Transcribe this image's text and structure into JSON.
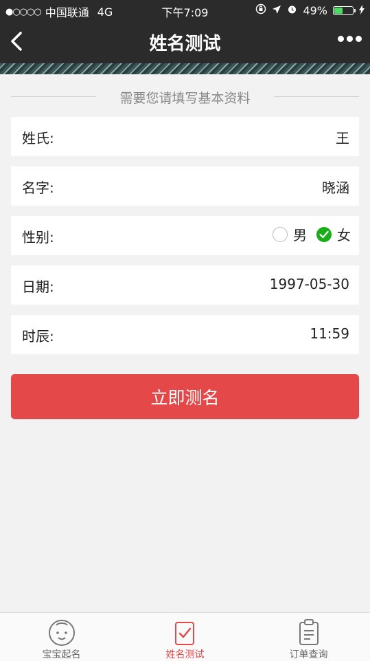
{
  "status_bar": {
    "signal_dots": "●○○○○",
    "carrier": "中国联通",
    "network": "4G",
    "time": "下午7:09",
    "battery_percent": "49%",
    "battery_level": 0.49
  },
  "nav": {
    "title": "姓名测试"
  },
  "section_heading": "需要您请填写基本资料",
  "form": {
    "surname": {
      "label": "姓氏:",
      "value": "王"
    },
    "given_name": {
      "label": "名字:",
      "value": "晓涵"
    },
    "gender": {
      "label": "性别:",
      "options": [
        "男",
        "女"
      ],
      "selected": "女"
    },
    "date": {
      "label": "日期:",
      "value": "1997-05-30"
    },
    "hour": {
      "label": "时辰:",
      "value": "11:59"
    }
  },
  "submit_label": "立即测名",
  "tabs": [
    {
      "label": "宝宝起名",
      "icon": "baby-face-icon"
    },
    {
      "label": "姓名测试",
      "icon": "name-test-icon",
      "active": true
    },
    {
      "label": "订单查询",
      "icon": "order-clipboard-icon"
    }
  ],
  "colors": {
    "nav_bg": "#2b2b2b",
    "accent_red": "#e54848",
    "check_green": "#1aad19",
    "page_bg": "#f2f2f2"
  }
}
